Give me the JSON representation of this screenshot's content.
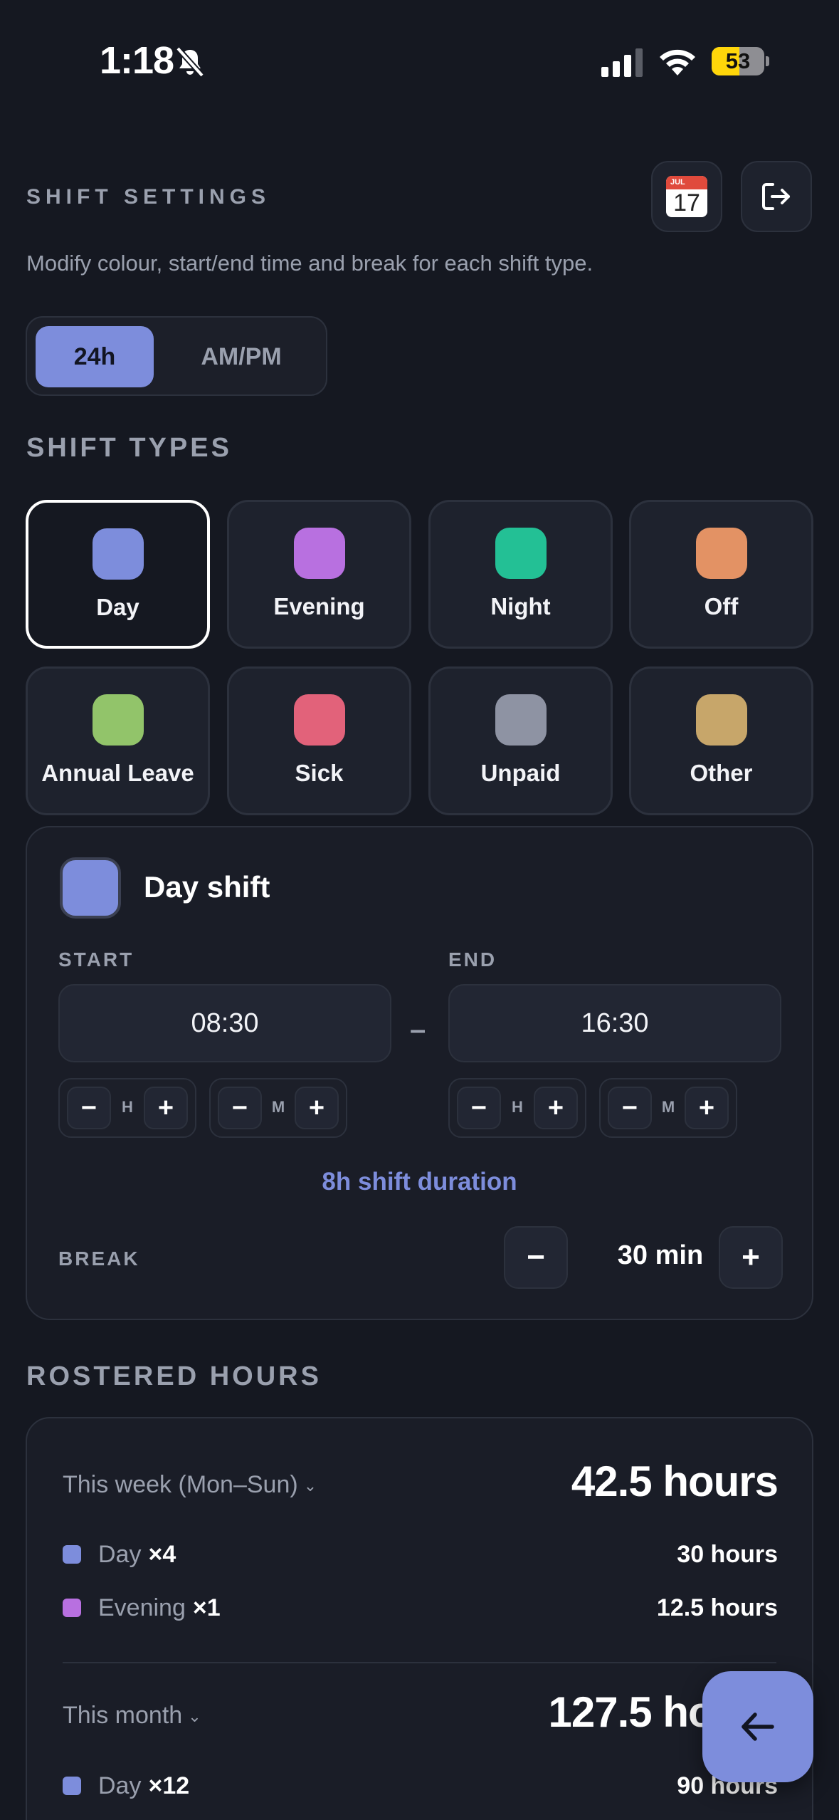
{
  "status": {
    "time": "1:18",
    "battery": "53",
    "battery_level": 0.53
  },
  "header": {
    "title": "SHIFT SETTINGS",
    "subtitle": "Modify colour, start/end time and break for each shift type.",
    "calendar_month": "JUL",
    "calendar_day": "17"
  },
  "format_toggle": {
    "options": [
      "24h",
      "AM/PM"
    ],
    "selected": "24h"
  },
  "shift_types": {
    "heading": "SHIFT TYPES",
    "items": [
      {
        "label": "Day",
        "color": "#7d8ddc",
        "selected": true
      },
      {
        "label": "Evening",
        "color": "#b870e0"
      },
      {
        "label": "Night",
        "color": "#23c095"
      },
      {
        "label": "Off",
        "color": "#e39264"
      },
      {
        "label": "Annual Leave",
        "color": "#92c46a"
      },
      {
        "label": "Sick",
        "color": "#e2627a"
      },
      {
        "label": "Unpaid",
        "color": "#8e93a3"
      },
      {
        "label": "Other",
        "color": "#c7a66a"
      }
    ]
  },
  "detail": {
    "title": "Day shift",
    "start_label": "START",
    "end_label": "END",
    "start_time": "08:30",
    "end_time": "16:30",
    "separator": "–",
    "hour_unit": "H",
    "minute_unit": "M",
    "minus": "−",
    "plus": "+",
    "duration": "8h shift duration",
    "break_label": "BREAK",
    "break_value": "30 min"
  },
  "rostered": {
    "heading": "ROSTERED HOURS",
    "week": {
      "label": "This week (Mon–Sun)",
      "chevron": "⌄",
      "total": "42.5 hours",
      "rows": [
        {
          "name": "Day",
          "count": "×4",
          "hours": "30 hours",
          "color": "#7d8ddc"
        },
        {
          "name": "Evening",
          "count": "×1",
          "hours": "12.5 hours",
          "color": "#b870e0"
        }
      ]
    },
    "month": {
      "label": "This month",
      "chevron": "⌄",
      "total": "127.5 hours",
      "rows": [
        {
          "name": "Day",
          "count": "×12",
          "hours": "90 hours",
          "color": "#7d8ddc"
        }
      ]
    }
  }
}
